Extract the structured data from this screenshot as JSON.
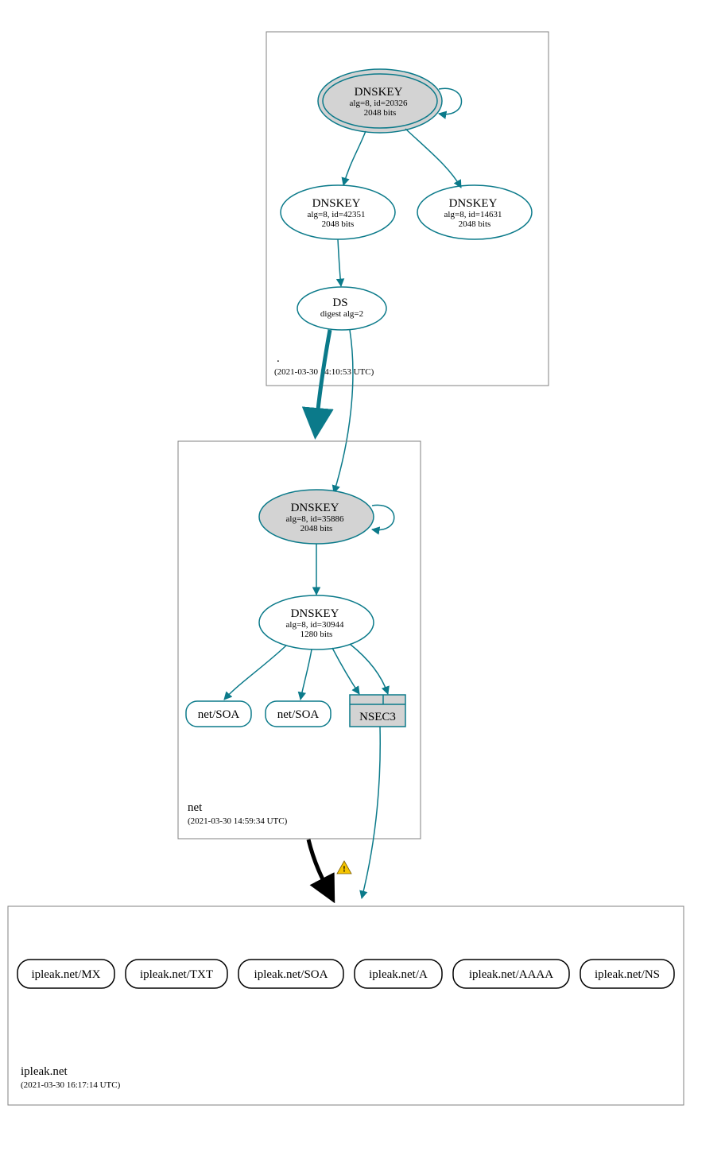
{
  "colors": {
    "teal": "#0b7a8a",
    "gray": "#d3d3d3",
    "black": "#000000"
  },
  "zones": {
    "root": {
      "name": ".",
      "timestamp": "(2021-03-30 14:10:53 UTC)"
    },
    "net": {
      "name": "net",
      "timestamp": "(2021-03-30 14:59:34 UTC)"
    },
    "ipleak": {
      "name": "ipleak.net",
      "timestamp": "(2021-03-30 16:17:14 UTC)"
    }
  },
  "nodes": {
    "root_ksk": {
      "title": "DNSKEY",
      "line2": "alg=8, id=20326",
      "line3": "2048 bits"
    },
    "root_zsk1": {
      "title": "DNSKEY",
      "line2": "alg=8, id=42351",
      "line3": "2048 bits"
    },
    "root_zsk2": {
      "title": "DNSKEY",
      "line2": "alg=8, id=14631",
      "line3": "2048 bits"
    },
    "root_ds": {
      "title": "DS",
      "line2": "digest alg=2"
    },
    "net_ksk": {
      "title": "DNSKEY",
      "line2": "alg=8, id=35886",
      "line3": "2048 bits"
    },
    "net_zsk": {
      "title": "DNSKEY",
      "line2": "alg=8, id=30944",
      "line3": "1280 bits"
    },
    "net_soa1": {
      "label": "net/SOA"
    },
    "net_soa2": {
      "label": "net/SOA"
    },
    "net_nsec3": {
      "label": "NSEC3"
    },
    "ipleak_mx": {
      "label": "ipleak.net/MX"
    },
    "ipleak_txt": {
      "label": "ipleak.net/TXT"
    },
    "ipleak_soa": {
      "label": "ipleak.net/SOA"
    },
    "ipleak_a": {
      "label": "ipleak.net/A"
    },
    "ipleak_aaaa": {
      "label": "ipleak.net/AAAA"
    },
    "ipleak_ns": {
      "label": "ipleak.net/NS"
    }
  },
  "warning_icon": "warning-icon"
}
